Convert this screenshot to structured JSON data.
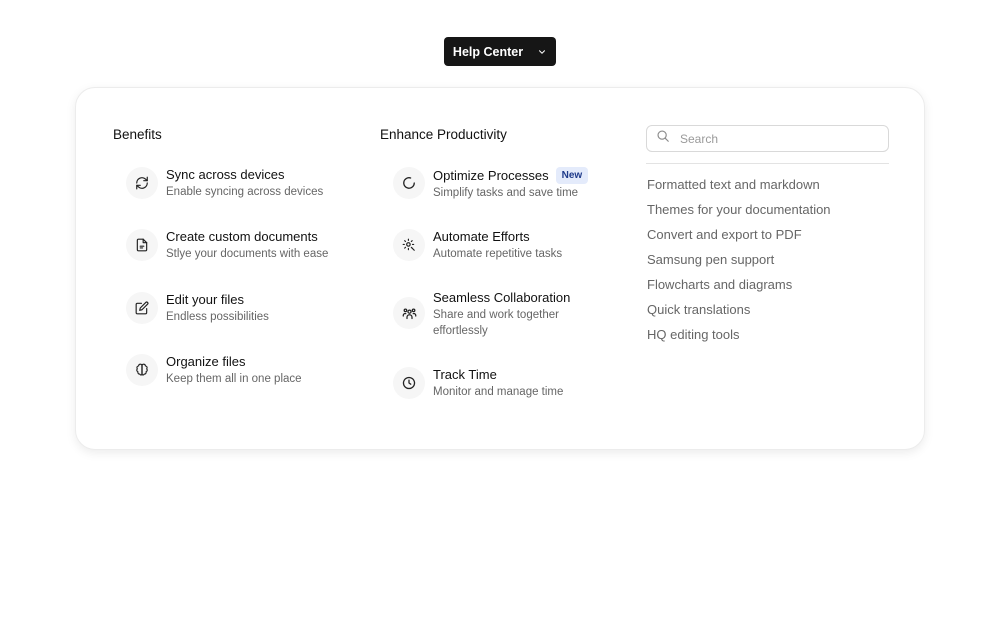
{
  "trigger": {
    "label": "Help Center",
    "icon": "chevron-down-icon"
  },
  "benefits": {
    "title": "Benefits",
    "items": [
      {
        "title": "Sync across devices",
        "desc": "Enable syncing across devices",
        "icon": "sync-icon"
      },
      {
        "title": "Create custom documents",
        "desc": "Stlye your documents with ease",
        "icon": "document-icon"
      },
      {
        "title": "Edit your files",
        "desc": "Endless possibilities",
        "icon": "edit-icon"
      },
      {
        "title": "Organize files",
        "desc": "Keep them all in one place",
        "icon": "brain-icon"
      }
    ]
  },
  "productivity": {
    "title": "Enhance Productivity",
    "items": [
      {
        "title": "Optimize Processes",
        "desc": "Simplify tasks and save time",
        "badge": "New",
        "icon": "loader-icon"
      },
      {
        "title": "Automate Efforts",
        "desc": "Automate repetitive tasks",
        "icon": "settings-automation-icon"
      },
      {
        "title": "Seamless Collaboration",
        "desc": "Share and work together effortlessly",
        "icon": "users-icon"
      },
      {
        "title": "Track Time",
        "desc": "Monitor and manage time",
        "icon": "clock-icon"
      }
    ]
  },
  "search": {
    "placeholder": "Search",
    "value": "",
    "icon": "search-icon"
  },
  "links": [
    "Formatted text and markdown",
    "Themes for your documentation",
    "Convert and export to PDF",
    "Samsung pen support",
    "Flowcharts and diagrams",
    "Quick translations",
    "HQ editing tools"
  ]
}
